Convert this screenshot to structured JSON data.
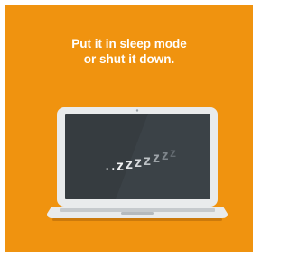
{
  "headline": {
    "line1": "Put it in sleep mode",
    "line2": "or shut it down."
  },
  "screen_text": {
    "dots": ". . .",
    "z1": "z",
    "z2": "z",
    "z3": "z",
    "z4": "z",
    "z5": "z",
    "z6": "z",
    "z7": "z"
  },
  "colors": {
    "background": "#f0930f",
    "frame": "#e9ebec",
    "screen": "#363c40",
    "base": "#cfd3d6",
    "shadow": "#b8630a"
  },
  "illustration": {
    "device": "laptop-icon"
  }
}
